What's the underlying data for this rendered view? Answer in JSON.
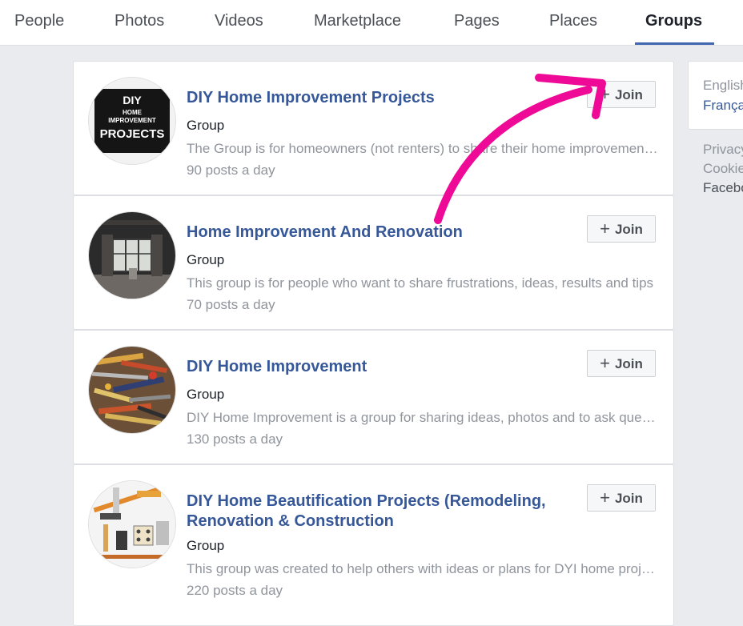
{
  "nav": {
    "tabs": [
      "People",
      "Photos",
      "Videos",
      "Marketplace",
      "Pages",
      "Places",
      "Groups"
    ],
    "active": "Groups"
  },
  "results": [
    {
      "name": "DIY Home Improvement Projects",
      "type": "Group",
      "description": "The Group is for homeowners (not renters) to share their home improvement projects",
      "activity": "90 posts a day",
      "join_label": "Join",
      "avatar_text": [
        "DIY",
        "HOME",
        "IMPROVEMENT",
        "PROJECTS"
      ]
    },
    {
      "name": "Home Improvement And Renovation",
      "type": "Group",
      "description": "This group is for people who want to share frustrations, ideas, results and tips",
      "activity": "70 posts a day",
      "join_label": "Join"
    },
    {
      "name": "DIY Home Improvement",
      "type": "Group",
      "description": "DIY Home Improvement is a group for sharing ideas, photos and to ask questions",
      "activity": "130 posts a day",
      "join_label": "Join"
    },
    {
      "name": "DIY Home Beautification Projects (Remodeling, Renovation & Construction",
      "type": "Group",
      "description": "This group was created to help others with ideas or plans for DYI home projects",
      "activity": "220 posts a day",
      "join_label": "Join"
    }
  ],
  "sidebar": {
    "language_current": "English",
    "language_alt": "Français",
    "footer_links": [
      "Privacy",
      "Cookies",
      "Facebook"
    ]
  },
  "annotation": {
    "arrow_color": "#ee0a96"
  },
  "colors": {
    "link": "#365899",
    "accent": "#4267b2",
    "background": "#e9ebee"
  }
}
